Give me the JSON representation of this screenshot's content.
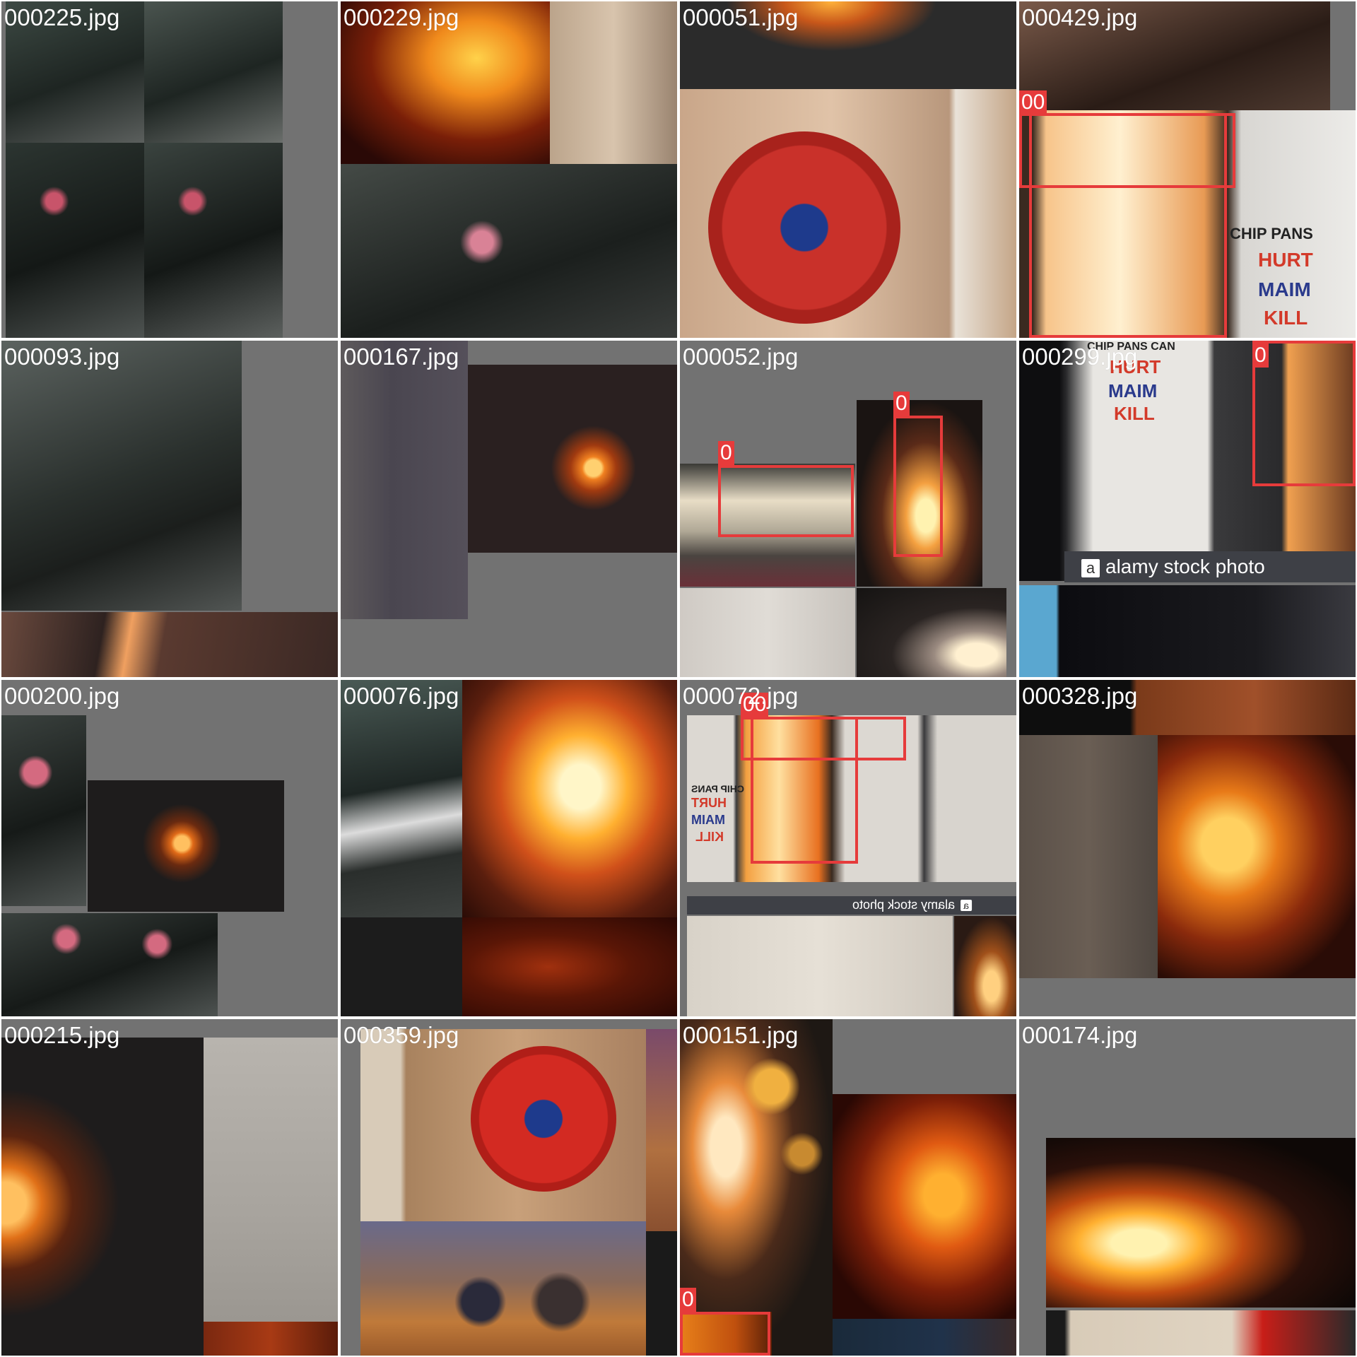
{
  "tiles": [
    {
      "filename": "000225.jpg"
    },
    {
      "filename": "000229.jpg"
    },
    {
      "filename": "000051.jpg"
    },
    {
      "filename": "000429.jpg"
    },
    {
      "filename": "000093.jpg"
    },
    {
      "filename": "000167.jpg"
    },
    {
      "filename": "000052.jpg"
    },
    {
      "filename": "000299.jpg"
    },
    {
      "filename": "000200.jpg"
    },
    {
      "filename": "000076.jpg"
    },
    {
      "filename": "000072.jpg"
    },
    {
      "filename": "000328.jpg"
    },
    {
      "filename": "000215.jpg"
    },
    {
      "filename": "000359.jpg"
    },
    {
      "filename": "000151.jpg"
    },
    {
      "filename": "000174.jpg"
    }
  ],
  "detection": {
    "class_tag": "0",
    "double_tag": "00",
    "box_color": "#e63b3b"
  },
  "watermark": {
    "text": "alamy stock photo",
    "icon_letter": "a"
  },
  "sign": {
    "line1": "CHIP PANS",
    "line2": "HURT",
    "line3": "MAIM",
    "line4": "KILL",
    "top_line": "CHIP PANS CAN",
    "partial": "HURT"
  }
}
